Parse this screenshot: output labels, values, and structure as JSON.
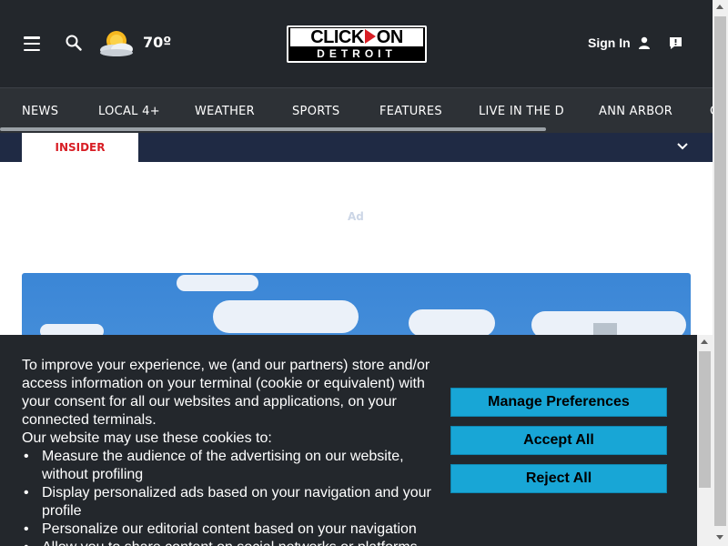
{
  "header": {
    "temperature": "70º",
    "logo_top_left": "CLICK",
    "logo_top_right": "ON",
    "logo_bottom": "DETROIT",
    "signin_label": "Sign In",
    "bg_color": "#23272c"
  },
  "nav": {
    "items": [
      "NEWS",
      "LOCAL 4+",
      "WEATHER",
      "SPORTS",
      "FEATURES",
      "LIVE IN THE D",
      "ANN ARBOR",
      "C"
    ]
  },
  "subnav": {
    "active_tab": "INSIDER"
  },
  "ad": {
    "label": "Ad"
  },
  "cookie_banner": {
    "intro": "To improve your experience, we (and our partners) store and/or access information on your terminal (cookie or equivalent) with your consent for all our websites and applications, on your connected terminals.",
    "lead": "Our website may use these cookies to:",
    "bullets": [
      "Measure the audience of the advertising on our website, without profiling",
      "Display personalized ads based on your navigation and your profile",
      "Personalize our editorial content based on your navigation",
      "Allow you to share content on social networks or platforms"
    ],
    "buttons": {
      "manage": "Manage Preferences",
      "accept": "Accept All",
      "reject": "Reject All"
    },
    "button_color": "#18a6d6"
  },
  "icons": {
    "menu": "hamburger-icon",
    "search": "search-icon",
    "weather": "partly-sunny-icon",
    "user": "user-icon",
    "chat": "chat-icon",
    "chevron": "chevron-down-icon"
  }
}
